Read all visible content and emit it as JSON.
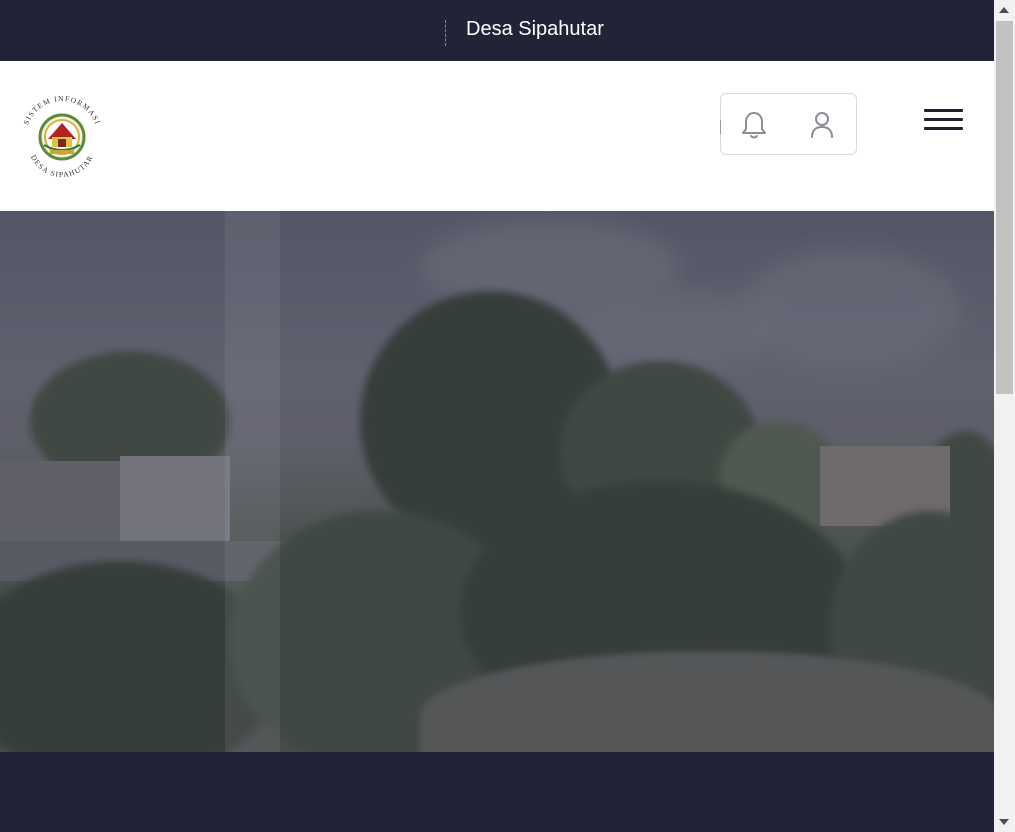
{
  "topbar": {
    "title": "Desa Sipahutar"
  },
  "header": {
    "logo": {
      "icon": "village-emblem-logo",
      "top_text": "SISTEM INFORMASI",
      "bottom_text": "DESA SIPAHUTAR"
    },
    "notification_icon": "bell-icon",
    "account_icon": "user-icon",
    "menu_icon": "hamburger-menu-icon"
  },
  "hero": {
    "image": "village landscape photo",
    "overlay_color": "#46465a"
  },
  "colors": {
    "navy": "#232338",
    "white": "#ffffff",
    "icon_gray": "#8c8c94"
  }
}
